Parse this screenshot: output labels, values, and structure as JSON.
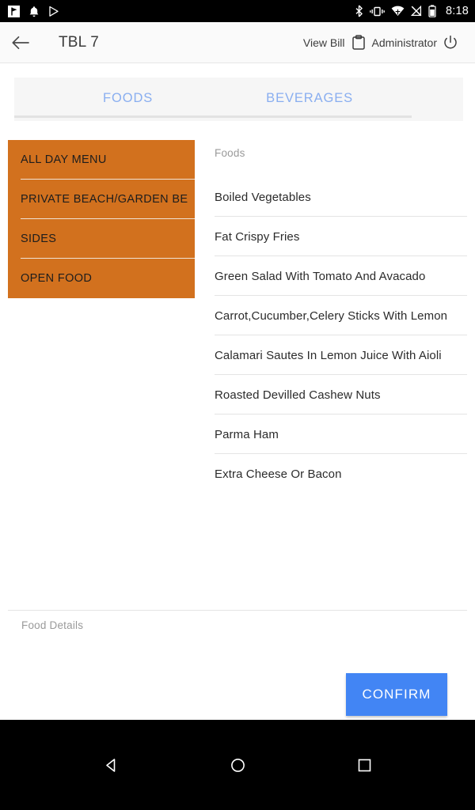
{
  "statusbar": {
    "time": "8:18",
    "left_icons": [
      "app-notification-icon",
      "bell-icon",
      "play-store-icon"
    ],
    "right_icons": [
      "bluetooth-icon",
      "vibrate-icon",
      "wifi-icon",
      "no-signal-icon",
      "battery-icon"
    ]
  },
  "appbar": {
    "back_icon": "back-arrow-icon",
    "title": "TBL 7",
    "view_bill_label": "View Bill",
    "bill_icon": "clipboard-icon",
    "user_label": "Administrator",
    "power_icon": "power-icon"
  },
  "tabs": [
    {
      "label": "FOODS"
    },
    {
      "label": "BEVERAGES"
    }
  ],
  "categories": [
    {
      "label": "ALL DAY MENU"
    },
    {
      "label": "PRIVATE BEACH/GARDEN BE"
    },
    {
      "label": "SIDES"
    },
    {
      "label": "OPEN FOOD"
    }
  ],
  "foods": {
    "header": "Foods",
    "items": [
      {
        "label": "Boiled Vegetables"
      },
      {
        "label": "Fat Crispy Fries"
      },
      {
        "label": "Green Salad With Tomato And Avacado"
      },
      {
        "label": "Carrot,Cucumber,Celery Sticks With Lemon"
      },
      {
        "label": "Calamari Sautes In Lemon Juice With Aioli"
      },
      {
        "label": "Roasted Devilled Cashew Nuts"
      },
      {
        "label": "Parma Ham"
      },
      {
        "label": "Extra Cheese Or Bacon"
      }
    ]
  },
  "details": {
    "label": "Food Details"
  },
  "footer": {
    "confirm_label": "CONFIRM"
  },
  "navbar": {
    "back_icon": "nav-back-icon",
    "home_icon": "nav-home-icon",
    "recents_icon": "nav-recents-icon"
  },
  "colors": {
    "category_orange": "#d2711e",
    "confirm_blue": "#4285f4",
    "tab_blue": "#89aef0"
  }
}
